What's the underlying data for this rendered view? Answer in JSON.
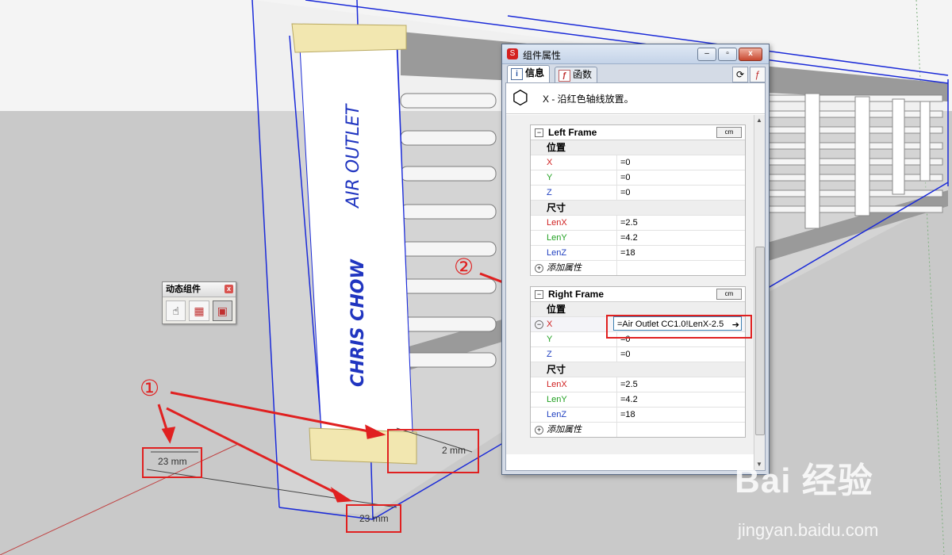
{
  "scene": {
    "label_air_outlet": "AIR OUTLET",
    "label_author": "CHRIS CHOW",
    "dims": [
      "23 mm",
      "2 mm",
      "23 mm"
    ],
    "markers": [
      "①",
      "②"
    ]
  },
  "toolbar": {
    "title": "动态组件",
    "close_glyph": "x",
    "buttons": [
      {
        "icon": "interact-hand-icon",
        "glyph": "☝"
      },
      {
        "icon": "component-options-icon",
        "glyph": "▦"
      },
      {
        "icon": "component-attributes-icon",
        "glyph": "▣"
      }
    ]
  },
  "dialog": {
    "title": "组件属性",
    "tabs": [
      {
        "label": "信息",
        "icon_glyph": "i"
      },
      {
        "label": "函数",
        "icon_glyph": "ƒ"
      }
    ],
    "hint": "X - 沿红色轴线放置。",
    "unit_label": "cm",
    "panels": [
      {
        "name": "Left Frame",
        "section_position": "位置",
        "section_size": "尺寸",
        "rows": [
          {
            "key": "X",
            "value": "=0"
          },
          {
            "key": "Y",
            "value": "=0"
          },
          {
            "key": "Z",
            "value": "=0"
          },
          {
            "key": "LenX",
            "value": "=2.5"
          },
          {
            "key": "LenY",
            "value": "=4.2"
          },
          {
            "key": "LenZ",
            "value": "=18"
          }
        ],
        "add_label": "添加属性"
      },
      {
        "name": "Right Frame",
        "section_position": "位置",
        "section_size": "尺寸",
        "rows": [
          {
            "key": "X",
            "value": "=Air Outlet CC1.0!LenX-2.5"
          },
          {
            "key": "Y",
            "value": "=0"
          },
          {
            "key": "Z",
            "value": "=0"
          },
          {
            "key": "LenX",
            "value": "=2.5"
          },
          {
            "key": "LenY",
            "value": "=4.2"
          },
          {
            "key": "LenZ",
            "value": "=18"
          }
        ],
        "add_label": "添加属性"
      }
    ]
  },
  "watermark": {
    "brand": "Bai 经验",
    "domain": "jingyan.baidu.com"
  },
  "colors": {
    "annotation_red": "#e02020",
    "edge_blue": "#1a2ad8",
    "axis_red": "#d02020",
    "axis_green": "#20a020",
    "axis_blue": "#2040c0"
  }
}
